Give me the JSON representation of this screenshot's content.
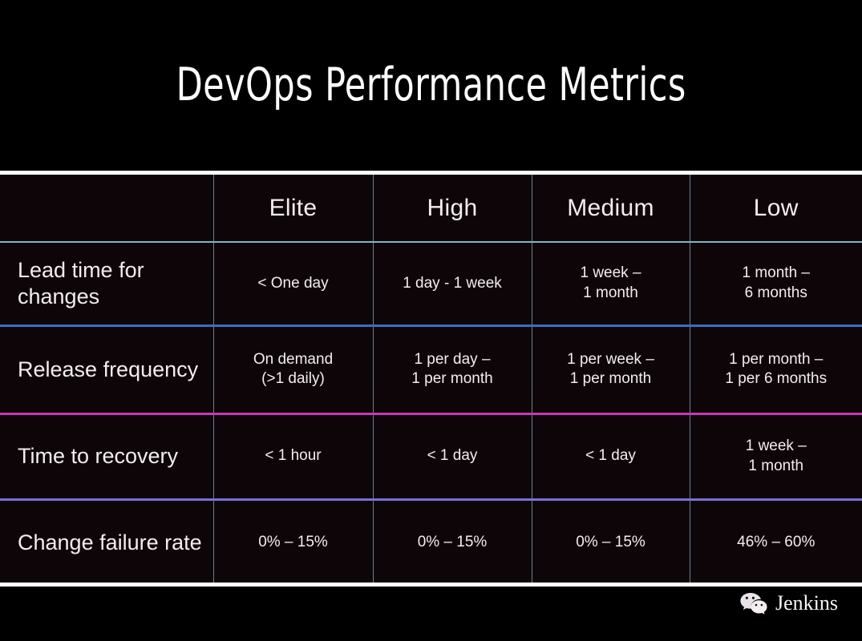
{
  "slide": {
    "title": "DevOps Performance Metrics"
  },
  "table": {
    "corner_header": "",
    "columns": [
      "Elite",
      "High",
      "Medium",
      "Low"
    ],
    "rows": [
      {
        "metric": "Lead time for changes",
        "cells": [
          [
            "< One day"
          ],
          [
            "1 day - 1 week"
          ],
          [
            "1 week –",
            "1 month"
          ],
          [
            "1 month –",
            "6 months"
          ]
        ],
        "divider_color": "#3a6fc4"
      },
      {
        "metric": "Release frequency",
        "cells": [
          [
            "On demand",
            "(>1 daily)"
          ],
          [
            "1 per day –",
            "1 per month"
          ],
          [
            "1 per week –",
            "1 per month"
          ],
          [
            "1 per month –",
            "1 per 6 months"
          ]
        ],
        "divider_color": "#c936b8"
      },
      {
        "metric": "Time to recovery",
        "cells": [
          [
            "< 1 hour"
          ],
          [
            "< 1 day"
          ],
          [
            "< 1 day"
          ],
          [
            "1 week –",
            "1 month"
          ]
        ],
        "divider_color": "#7b6fd4"
      },
      {
        "metric": "Change failure rate",
        "cells": [
          [
            "0% – 15%"
          ],
          [
            "0% – 15%"
          ],
          [
            "0% – 15%"
          ],
          [
            "46% – 60%"
          ]
        ],
        "divider_color": ""
      }
    ]
  },
  "footer": {
    "icon": "wechat-icon",
    "label": "Jenkins"
  },
  "colors": {
    "background": "#000000",
    "table_background": "#0e0508",
    "text": "#f2edf2",
    "header_underline": "#7fb5c8",
    "column_divider": "#6d7f92",
    "rule": "#fdfdfd"
  }
}
